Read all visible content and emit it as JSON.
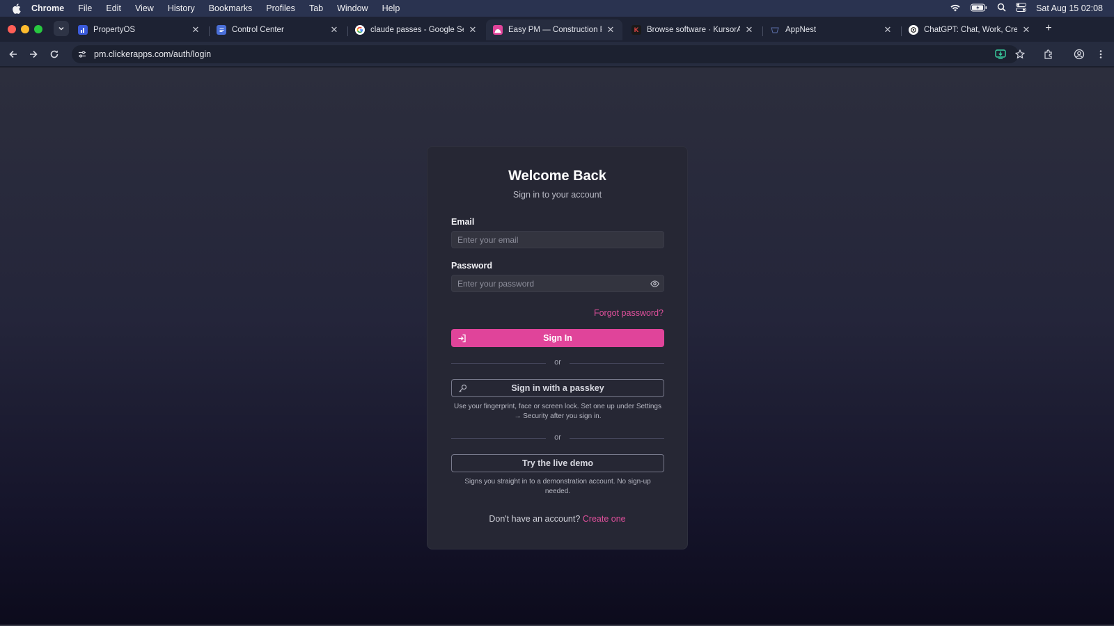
{
  "menubar": {
    "app": "Chrome",
    "items": [
      "File",
      "Edit",
      "View",
      "History",
      "Bookmarks",
      "Profiles",
      "Tab",
      "Window",
      "Help"
    ],
    "clock": "Sat Aug 15  02:08",
    "icons": [
      "wifi-icon",
      "battery-icon",
      "spotlight-search-icon",
      "control-center-icon"
    ]
  },
  "tabs": [
    {
      "title": "PropertyOS",
      "favicon": "propertyos-icon",
      "favicon_color": "#3b5bdb",
      "active": false
    },
    {
      "title": "Control Center",
      "favicon": "document-icon",
      "favicon_color": "#4a6fd8",
      "active": false
    },
    {
      "title": "claude passes - Google Search",
      "favicon": "google-icon",
      "favicon_color": "#ffffff",
      "active": false
    },
    {
      "title": "Easy PM — Construction Project",
      "favicon": "easy-pm-icon",
      "favicon_color": "#e0449a",
      "active": true
    },
    {
      "title": "Browse software · KursorApps",
      "favicon": "kursorapps-icon",
      "favicon_color": "#1a1a1a",
      "favicon_letter": "K",
      "active": false
    },
    {
      "title": "AppNest",
      "favicon": "appnest-icon",
      "favicon_color": "#3a3f55",
      "active": false
    },
    {
      "title": "ChatGPT: Chat, Work, Create",
      "favicon": "chatgpt-icon",
      "favicon_color": "#ffffff",
      "active": false
    }
  ],
  "toolbar": {
    "url": "pm.clickerapps.com/auth/login"
  },
  "login": {
    "title": "Welcome Back",
    "subtitle": "Sign in to your account",
    "email_label": "Email",
    "email_placeholder": "Enter your email",
    "email_value": "",
    "password_label": "Password",
    "password_placeholder": "Enter your password",
    "password_value": "",
    "forgot": "Forgot password?",
    "signin": "Sign In",
    "or_1": "or",
    "passkey": "Sign in with a passkey",
    "passkey_help": "Use your fingerprint, face or screen lock. Set one up under Settings → Security after you sign in.",
    "or_2": "or",
    "demo": "Try the live demo",
    "demo_help": "Signs you straight in to a demonstration account. No sign-up needed.",
    "no_account": "Don't have an account?",
    "create": "Create one"
  },
  "colors": {
    "accent": "#e0449a",
    "link": "#e0509c",
    "card_bg": "#262734"
  }
}
